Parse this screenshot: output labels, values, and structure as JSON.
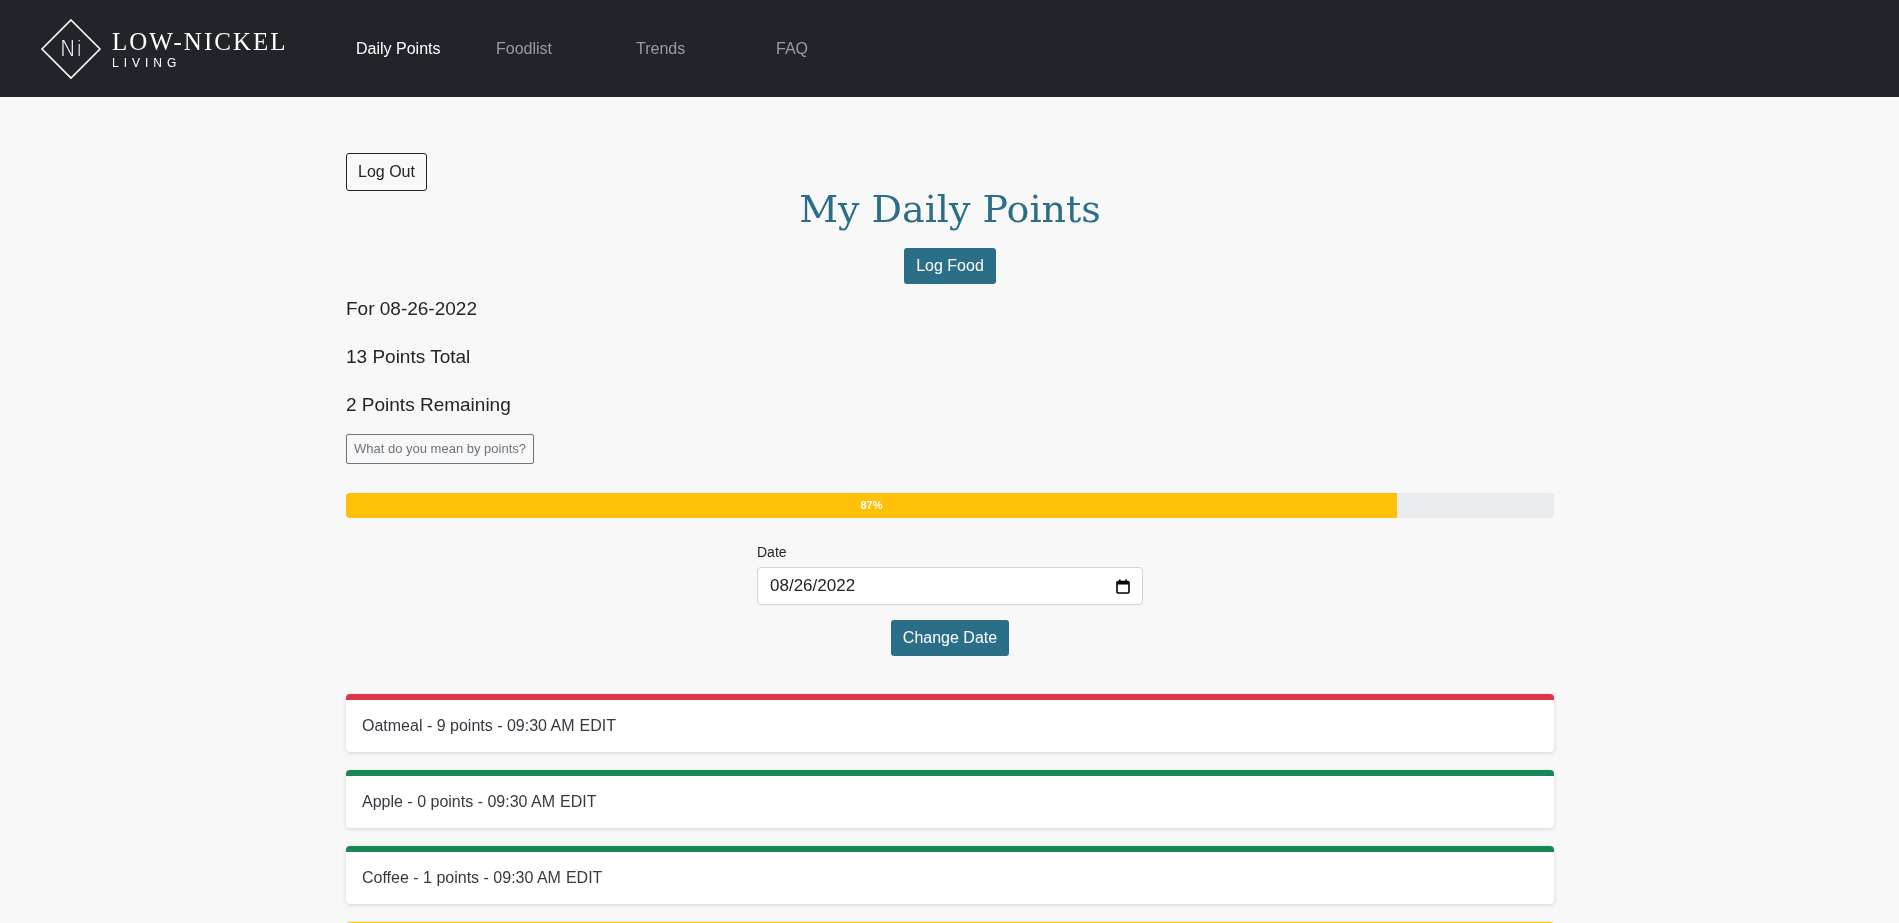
{
  "navbar": {
    "logo": {
      "mark": "Ni",
      "name": "LOW-NICKEL",
      "tagline": "LIVING"
    },
    "links": [
      {
        "label": "Daily Points",
        "selected": true
      },
      {
        "label": "Foodlist",
        "selected": false
      },
      {
        "label": "Trends",
        "selected": false
      },
      {
        "label": "FAQ",
        "selected": false
      }
    ]
  },
  "logout_button": "Log Out",
  "title": "My Daily Points",
  "log_food_button": "Log Food",
  "summary": [
    "For 08-26-2022",
    "13 Points Total",
    "2 Points Remaining"
  ],
  "points_help_button": "What do you mean by points?",
  "progress": {
    "level": 0.87,
    "label": "87%"
  },
  "date_field": {
    "label": "Date",
    "value": "08/26/2022"
  },
  "change_date_button": "Change Date",
  "entries": [
    {
      "text": "Oatmeal - 9 points - 09:30 AM",
      "action": "EDIT",
      "color": "#dc3545"
    },
    {
      "text": "Apple - 0 points - 09:30 AM",
      "action": "EDIT",
      "color": "#198754"
    },
    {
      "text": "Coffee - 1 points - 09:30 AM",
      "action": "EDIT",
      "color": "#198754"
    },
    {
      "color": "#ffc107"
    }
  ]
}
